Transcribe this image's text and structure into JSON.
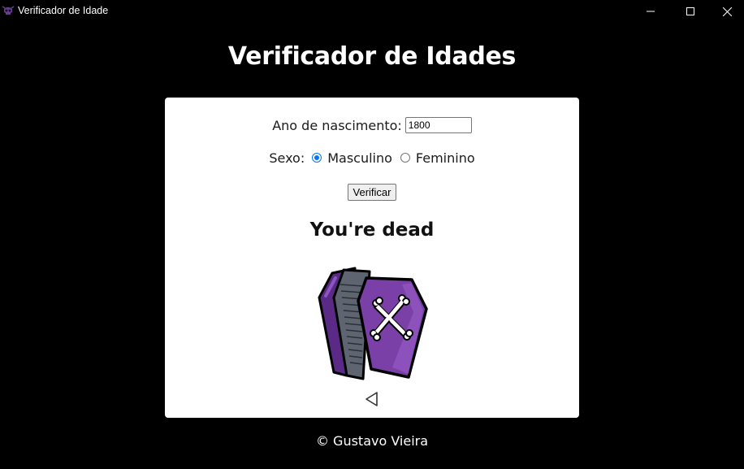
{
  "window": {
    "title": "Verificador de Idade",
    "app_icon": "skull-icon",
    "controls": [
      "minimize-icon",
      "maximize-icon",
      "close-icon"
    ]
  },
  "page": {
    "heading": "Verificador de Idades"
  },
  "form": {
    "year_label": "Ano de nascimento:",
    "year_value": "1800",
    "sex_label": "Sexo:",
    "sex_options": [
      {
        "label": "Masculino",
        "checked": true
      },
      {
        "label": "Feminino",
        "checked": false
      }
    ],
    "submit_label": "Verificar"
  },
  "result": {
    "text": "You're dead",
    "image_icon": "coffin-icon",
    "back_icon": "triangle-left-icon"
  },
  "footer": {
    "text": "© Gustavo Vieira"
  },
  "colors": {
    "background": "#000000",
    "card": "#ffffff",
    "radio_accent": "#0075ff",
    "coffin_purple": "#7b3fa8"
  }
}
